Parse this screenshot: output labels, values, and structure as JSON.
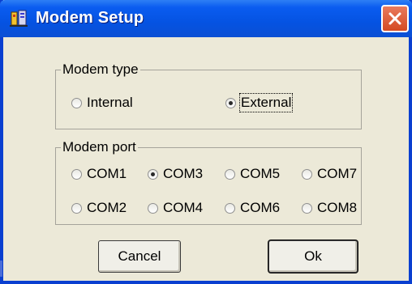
{
  "window": {
    "title": "Modem Setup",
    "icon": "modem-setup-icon",
    "close_icon": "close-x-icon"
  },
  "modem_type": {
    "legend": "Modem type",
    "options": [
      {
        "label": "Internal",
        "checked": false
      },
      {
        "label": "External",
        "checked": true
      }
    ]
  },
  "modem_port": {
    "legend": "Modem port",
    "options": [
      {
        "label": "COM1",
        "checked": false
      },
      {
        "label": "COM3",
        "checked": true
      },
      {
        "label": "COM5",
        "checked": false
      },
      {
        "label": "COM7",
        "checked": false
      },
      {
        "label": "COM2",
        "checked": false
      },
      {
        "label": "COM4",
        "checked": false
      },
      {
        "label": "COM6",
        "checked": false
      },
      {
        "label": "COM8",
        "checked": false
      }
    ]
  },
  "buttons": {
    "cancel": "Cancel",
    "ok": "Ok"
  },
  "colors": {
    "titlebar": "#0553e2",
    "dialog_bg": "#ece9d8",
    "close_button": "#d44a22"
  }
}
